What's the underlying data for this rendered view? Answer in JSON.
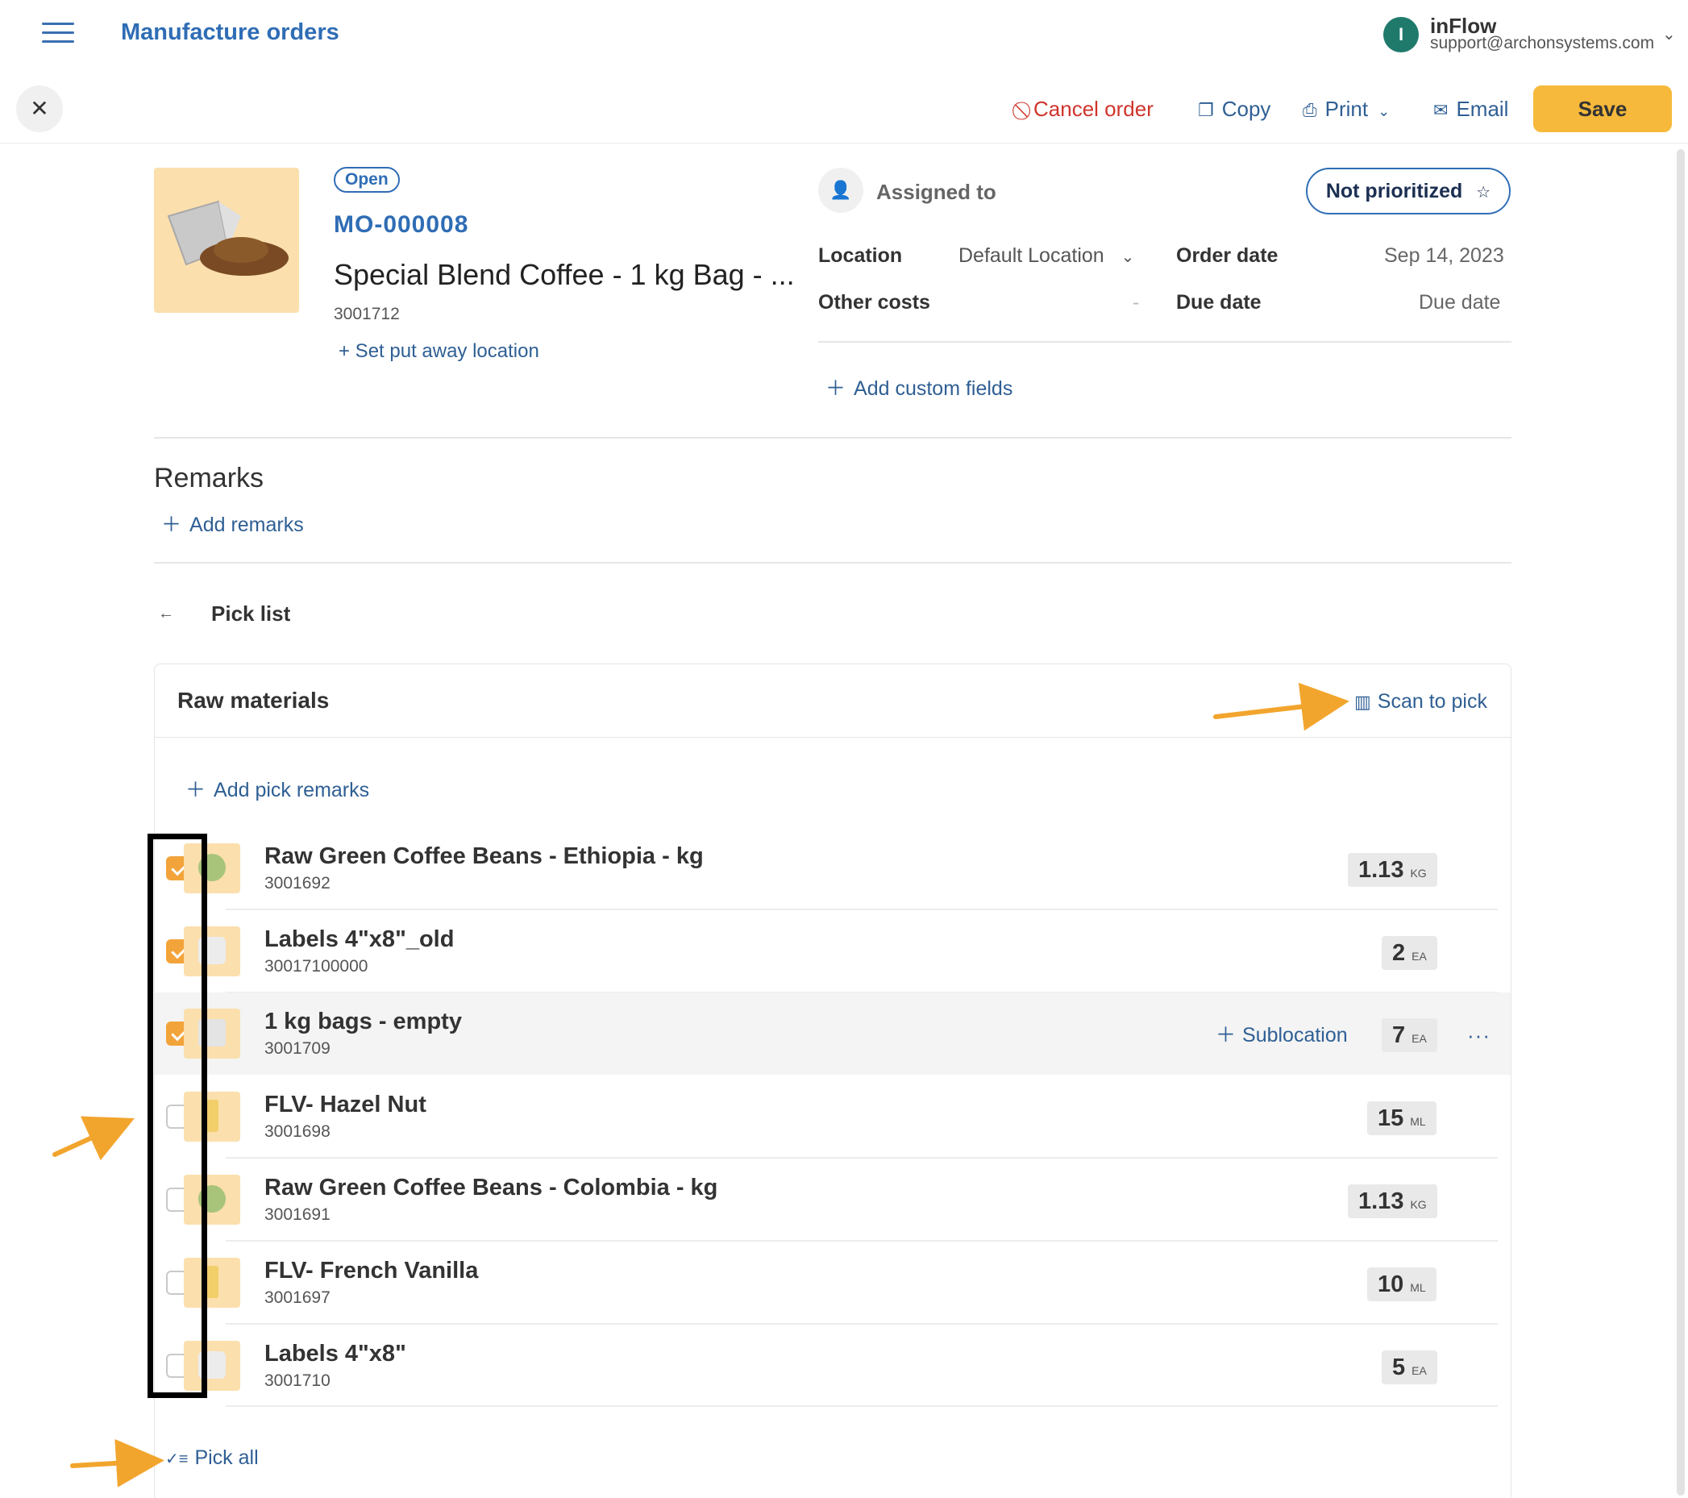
{
  "header": {
    "title": "Manufacture orders",
    "account": {
      "initial": "I",
      "name": "inFlow",
      "email": "support@archonsystems.com"
    }
  },
  "actions": {
    "cancel": "Cancel order",
    "copy": "Copy",
    "print": "Print",
    "email": "Email",
    "save": "Save"
  },
  "order": {
    "status": "Open",
    "number": "MO-000008",
    "product_name": "Special Blend Coffee - 1 kg Bag - ...",
    "product_sku": "3001712",
    "put_away": "+ Set put away location",
    "assigned_to": "Assigned to",
    "priority": "Not prioritized",
    "location_label": "Location",
    "location_value": "Default Location",
    "order_date_label": "Order date",
    "order_date_value": "Sep 14, 2023",
    "other_costs_label": "Other costs",
    "other_costs_value": "-",
    "due_date_label": "Due date",
    "due_date_value": "Due date",
    "add_custom_fields": "Add custom fields"
  },
  "remarks": {
    "title": "Remarks",
    "add": "Add remarks"
  },
  "pick_list": {
    "title": "Pick list",
    "section_title": "Raw materials",
    "scan_to_pick": "Scan to pick",
    "add_pick_remarks": "Add pick remarks",
    "sublocation": "Sublocation",
    "more": "···",
    "pick_all": "Pick all",
    "items": [
      {
        "name": "Raw Green Coffee Beans - Ethiopia - kg",
        "sku": "3001692",
        "qty": "1.13",
        "unit": "KG",
        "checked": true
      },
      {
        "name": "Labels 4\"x8\"_old",
        "sku": "30017100000",
        "qty": "2",
        "unit": "EA",
        "checked": true
      },
      {
        "name": "1 kg bags - empty",
        "sku": "3001709",
        "qty": "7",
        "unit": "EA",
        "checked": true
      },
      {
        "name": "FLV- Hazel Nut",
        "sku": "3001698",
        "qty": "15",
        "unit": "ML",
        "checked": false
      },
      {
        "name": "Raw Green Coffee Beans - Colombia - kg",
        "sku": "3001691",
        "qty": "1.13",
        "unit": "KG",
        "checked": false
      },
      {
        "name": "FLV- French Vanilla",
        "sku": "3001697",
        "qty": "10",
        "unit": "ML",
        "checked": false
      },
      {
        "name": "Labels 4\"x8\"",
        "sku": "3001710",
        "qty": "5",
        "unit": "EA",
        "checked": false
      }
    ]
  },
  "colors": {
    "brand_blue": "#2f6db5",
    "save_yellow": "#f6b93b",
    "cancel_red": "#d0342c",
    "checkbox_orange": "#f2a43a",
    "annotation_orange": "#f2a52d"
  }
}
